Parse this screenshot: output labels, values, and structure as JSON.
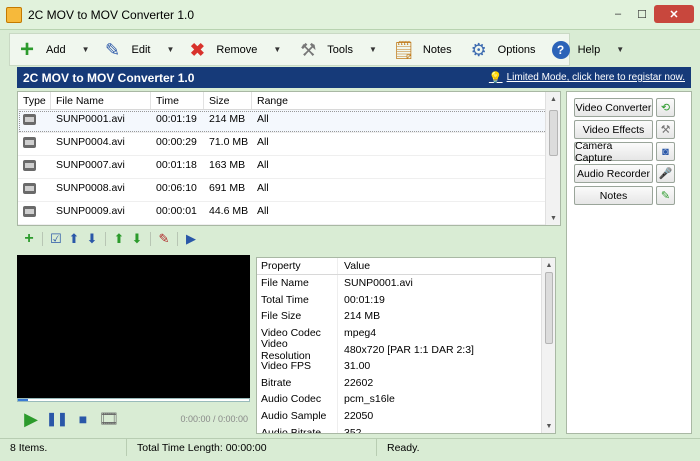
{
  "window": {
    "title": "2C MOV to MOV Converter 1.0",
    "minimize": "–",
    "maximize": "☐",
    "close": "✕"
  },
  "toolbar": {
    "add": "Add",
    "edit": "Edit",
    "remove": "Remove",
    "tools": "Tools",
    "notes": "Notes",
    "options": "Options",
    "help": "Help"
  },
  "banner": {
    "title": "2C MOV to MOV Converter 1.0",
    "link": "Limited Mode, click here to registar now."
  },
  "filelist": {
    "headers": [
      "Type",
      "File Name",
      "Time",
      "Size",
      "Range"
    ],
    "rows": [
      {
        "name": "SUNP0001.avi",
        "time": "00:01:19",
        "size": "214 MB",
        "range": "All"
      },
      {
        "name": "SUNP0004.avi",
        "time": "00:00:29",
        "size": "71.0 MB",
        "range": "All"
      },
      {
        "name": "SUNP0007.avi",
        "time": "00:01:18",
        "size": "163 MB",
        "range": "All"
      },
      {
        "name": "SUNP0008.avi",
        "time": "00:06:10",
        "size": "691 MB",
        "range": "All"
      },
      {
        "name": "SUNP0009.avi",
        "time": "00:00:01",
        "size": "44.6 MB",
        "range": "All"
      }
    ]
  },
  "player": {
    "time": "0:00:00 / 0:00:00"
  },
  "properties": {
    "headers": [
      "Property",
      "Value"
    ],
    "rows": [
      {
        "k": "File Name",
        "v": "SUNP0001.avi"
      },
      {
        "k": "Total Time",
        "v": "00:01:19"
      },
      {
        "k": "File Size",
        "v": "214 MB"
      },
      {
        "k": "Video Codec",
        "v": "mpeg4"
      },
      {
        "k": "Video Resolution",
        "v": "480x720 [PAR 1:1 DAR 2:3]"
      },
      {
        "k": "Video FPS",
        "v": "31.00"
      },
      {
        "k": "Bitrate",
        "v": "22602"
      },
      {
        "k": "Audio Codec",
        "v": "pcm_s16le"
      },
      {
        "k": "Audio Sample",
        "v": "22050"
      },
      {
        "k": "Audio Bitrate",
        "v": "352"
      }
    ]
  },
  "side": {
    "video_converter": "Video Converter",
    "video_effects": "Video Effects",
    "camera_capture": "Camera Capture",
    "audio_recorder": "Audio Recorder",
    "notes": "Notes"
  },
  "status": {
    "items": "8 Items.",
    "total": "Total Time Length: 00:00:00",
    "ready": "Ready."
  },
  "colors": {
    "banner": "#163a79",
    "background": "#d9ecd4"
  }
}
